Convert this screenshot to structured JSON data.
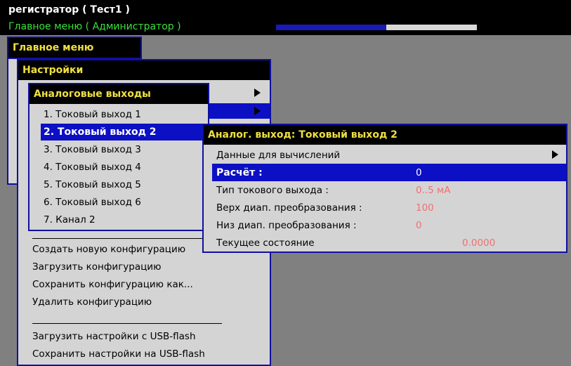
{
  "header": {
    "title": "регистратор ( Тест1 )",
    "subtitle": "Главное меню ( Администратор )",
    "progress": 0.55
  },
  "main_menu": {
    "title": "Главное меню"
  },
  "settings_menu": {
    "title": "Настройки",
    "items": [
      "Создать новую конфигурацию",
      "Загрузить конфигурацию",
      "Сохранить конфигурацию как...",
      "Удалить конфигурацию",
      "Загрузить настройки с USB-flash",
      "Сохранить настройки на USB-flash"
    ]
  },
  "analog_menu": {
    "title": "Аналоговые выходы",
    "items": [
      "1. Токовый выход 1",
      "2. Токовый выход 2",
      "3. Токовый выход 3",
      "4. Токовый выход 4",
      "5. Токовый выход 5",
      "6. Токовый выход 6",
      "7. Канал 2"
    ],
    "selected_index": 1
  },
  "output_dialog": {
    "title": "Аналог. выход: Токовый выход 2",
    "rows": [
      {
        "label": "Данные для вычислений",
        "value": ""
      },
      {
        "label": "Расчёт :",
        "value": "0"
      },
      {
        "label": "Тип токового выхода :",
        "value": "0..5 мА"
      },
      {
        "label": "Верх диап. преобразования :",
        "value": "100"
      },
      {
        "label": "Низ диап. преобразования :",
        "value": "0"
      },
      {
        "label": "Текущее состояние",
        "value": "0.0000"
      }
    ]
  },
  "colors": {
    "background": "#808080",
    "selection": "#0c10c4",
    "title_text": "#f0e040",
    "value_text": "#f07070",
    "subtitle_text": "#3be03b"
  }
}
